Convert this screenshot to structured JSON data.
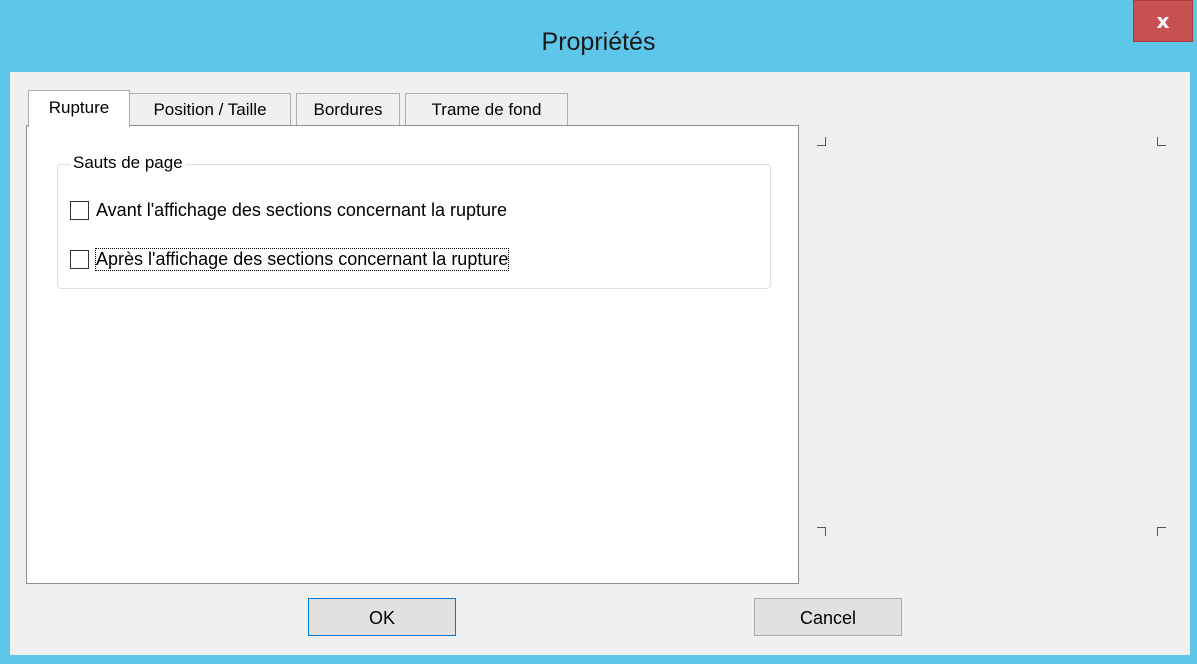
{
  "window": {
    "title": "Propriétés",
    "close_label": "x"
  },
  "tabs": [
    {
      "label": "Rupture",
      "active": true
    },
    {
      "label": "Position / Taille",
      "active": false
    },
    {
      "label": "Bordures",
      "active": false
    },
    {
      "label": "Trame de fond",
      "active": false
    }
  ],
  "group": {
    "legend": "Sauts de page",
    "options": [
      {
        "label": "Avant l'affichage des sections concernant la rupture",
        "checked": false
      },
      {
        "label": "Après l'affichage des sections concernant la rupture",
        "checked": false
      }
    ]
  },
  "buttons": {
    "ok": "OK",
    "cancel": "Cancel"
  },
  "colors": {
    "titlebar": "#5ec6e8",
    "close": "#c75050",
    "default_button_border": "#0078d7"
  }
}
